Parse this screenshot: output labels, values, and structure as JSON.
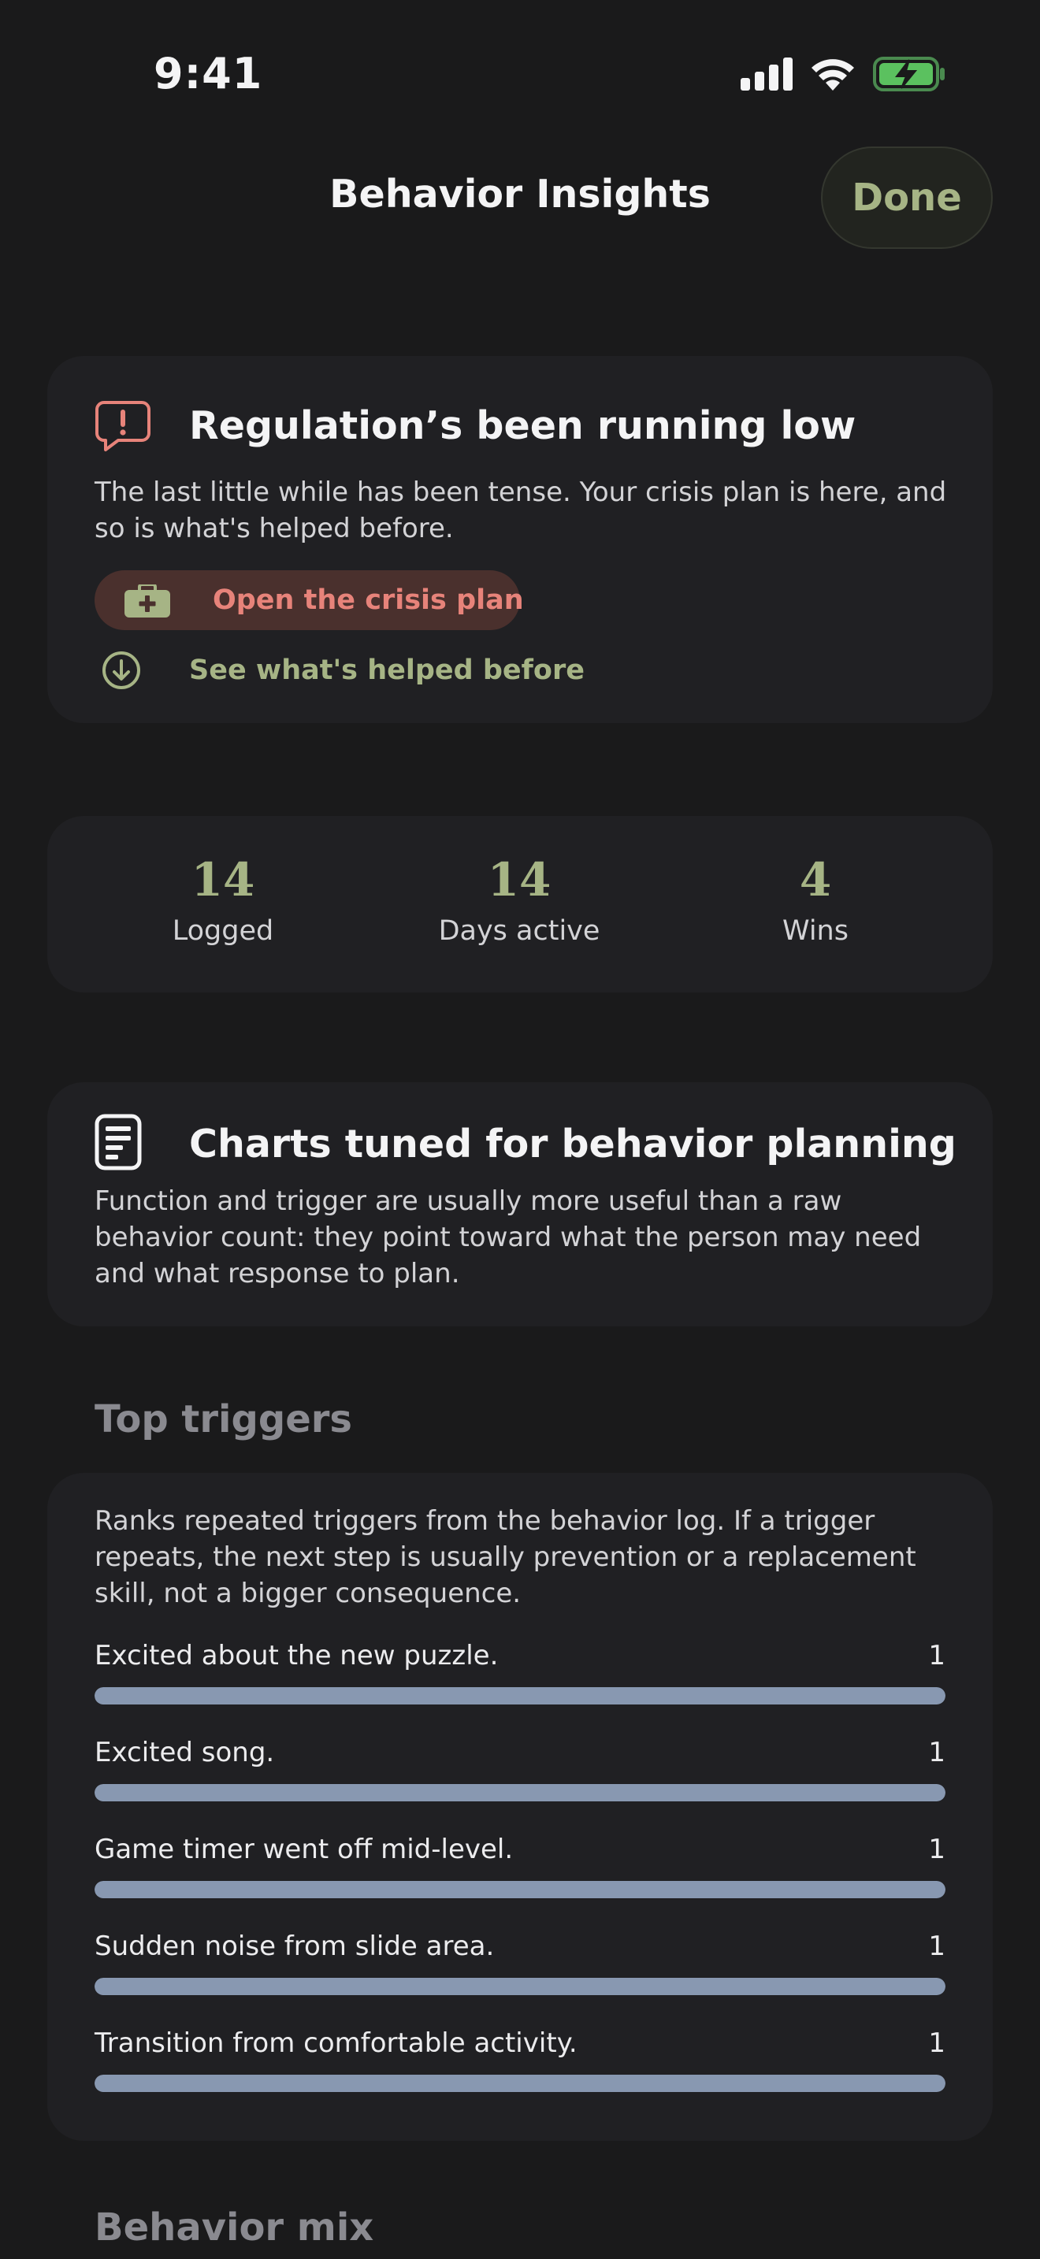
{
  "status_bar": {
    "time": "9:41"
  },
  "nav": {
    "title": "Behavior Insights",
    "done_label": "Done"
  },
  "crisis_card": {
    "title": "Regulation’s been running low",
    "body": "The last little while has been tense. Your crisis plan is here, and so is what's helped before.",
    "plan_button_label": "Open the crisis plan",
    "helped_link_label": "See what's helped before",
    "colors": {
      "alert": "#e7837a",
      "accent": "#a6b485"
    }
  },
  "stats": [
    {
      "value": "14",
      "label": "Logged"
    },
    {
      "value": "14",
      "label": "Days active"
    },
    {
      "value": "4",
      "label": "Wins"
    }
  ],
  "charts_info": {
    "title": "Charts tuned for behavior planning",
    "body": "Function and trigger are usually more useful than a raw behavior count: they point toward what the person may need and what response to plan."
  },
  "top_triggers": {
    "heading": "Top triggers",
    "description": "Ranks repeated triggers from the behavior log. If a trigger repeats, the next step is usually prevention or a replacement skill, not a bigger consequence.",
    "bar_color": "#8898b1",
    "items": [
      {
        "label": "Excited about the new puzzle.",
        "count": "1",
        "fill": 1.0
      },
      {
        "label": "Excited song.",
        "count": "1",
        "fill": 1.0
      },
      {
        "label": "Game timer went off mid-level.",
        "count": "1",
        "fill": 1.0
      },
      {
        "label": "Sudden noise from slide area.",
        "count": "1",
        "fill": 1.0
      },
      {
        "label": "Transition from comfortable activity.",
        "count": "1",
        "fill": 1.0
      }
    ]
  },
  "behavior_mix": {
    "heading": "Behavior mix"
  }
}
